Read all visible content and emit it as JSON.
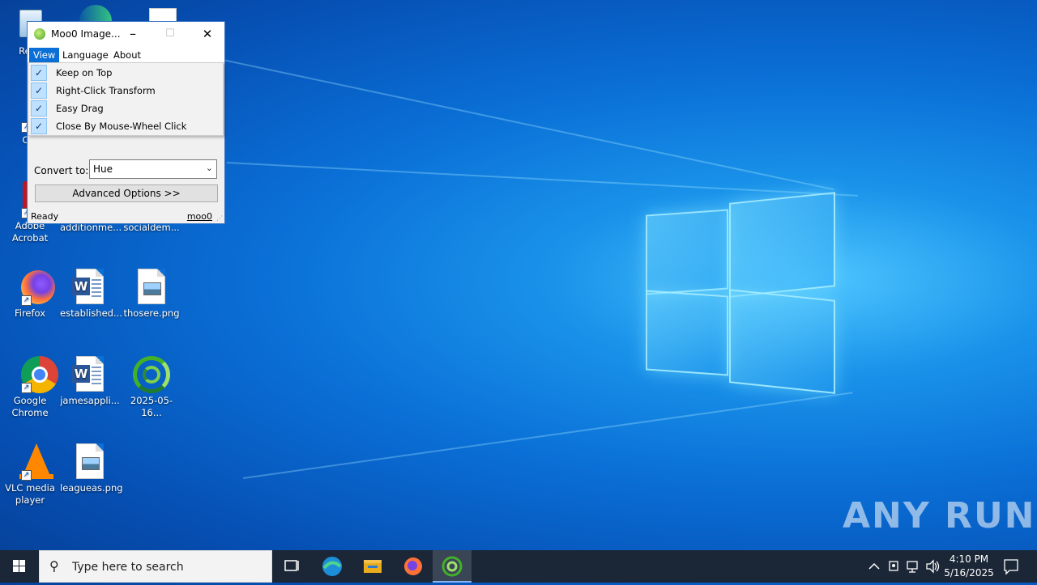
{
  "desktop": {
    "icons": [
      {
        "label": "Recy",
        "type": "recycle"
      },
      {
        "label": "CCl",
        "type": "ccleaner"
      },
      {
        "label": "Adobe Acrobat",
        "type": "acrobat"
      },
      {
        "label": "additionme...",
        "type": "doc"
      },
      {
        "label": "socialdem...",
        "type": "doc"
      },
      {
        "label": "Firefox",
        "type": "firefox"
      },
      {
        "label": "established...",
        "type": "word"
      },
      {
        "label": "thosere.png",
        "type": "image"
      },
      {
        "label": "Google Chrome",
        "type": "chrome"
      },
      {
        "label": "jamesappli...",
        "type": "word"
      },
      {
        "label": "2025-05-16...",
        "type": "moo0"
      },
      {
        "label": "VLC media player",
        "type": "vlc"
      },
      {
        "label": "leagueas.png",
        "type": "image"
      }
    ],
    "watermark": "ANY RUN"
  },
  "window": {
    "title": "Moo0 Image...",
    "minimize": "–",
    "maximize": "☐",
    "close": "✕",
    "menu": [
      {
        "label": "View",
        "active": true
      },
      {
        "label": "Language",
        "active": false
      },
      {
        "label": "About",
        "active": false
      }
    ],
    "dropdown": [
      {
        "label": "Keep on Top",
        "checked": true
      },
      {
        "label": "Right-Click Transform",
        "checked": true
      },
      {
        "label": "Easy Drag",
        "checked": true
      },
      {
        "label": "Close By Mouse-Wheel Click",
        "checked": true
      }
    ],
    "convert_label": "Convert to:",
    "convert_value": "Hue",
    "advanced_button": "Advanced Options >>",
    "status": "Ready",
    "link": "moo0"
  },
  "taskbar": {
    "search_placeholder": "Type here to search",
    "time": "4:10 PM",
    "date": "5/16/2025"
  },
  "colors": {
    "accent": "#0a6fd6",
    "taskbar": "#1b2636"
  }
}
